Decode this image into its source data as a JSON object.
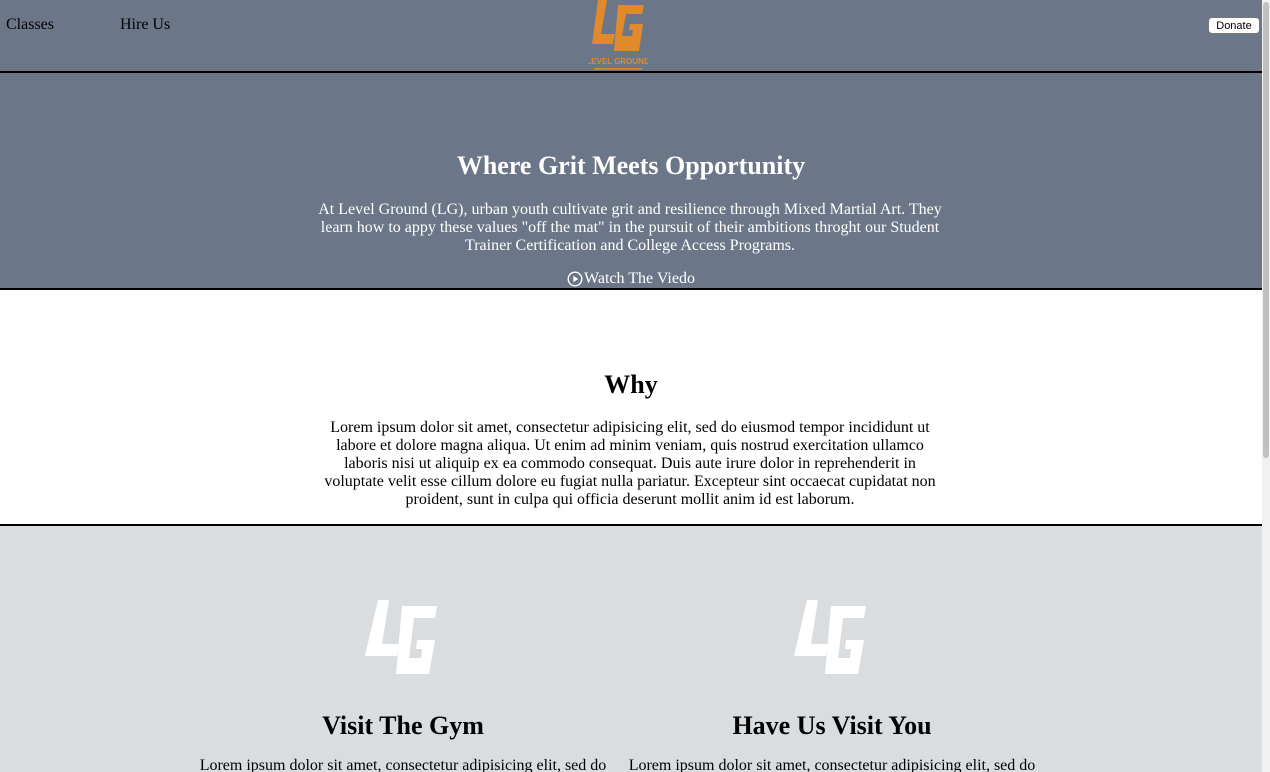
{
  "nav": {
    "classes_label": "Classes",
    "hire_label": "Hire Us",
    "donate_label": "Donate",
    "logo_icon": "level-ground-logo",
    "logo_caption": "LEVEL GROUND"
  },
  "hero": {
    "title": "Where Grit Meets Opportunity",
    "body": "At Level Ground (LG), urban youth cultivate grit and resilience through Mixed Martial Art. They learn how to appy these values \"off the mat\" in the pursuit of their ambitions throght our Student Trainer Certification and College Access Programs.",
    "watch_label": "Watch The Viedo",
    "watch_icon": "play-circle-icon"
  },
  "why": {
    "title": "Why",
    "body": "Lorem ipsum dolor sit amet, consectetur adipisicing elit, sed do eiusmod tempor incididunt ut labore et dolore magna aliqua. Ut enim ad minim veniam, quis nostrud exercitation ullamco laboris nisi ut aliquip ex ea commodo consequat. Duis aute irure dolor in reprehenderit in voluptate velit esse cillum dolore eu fugiat nulla pariatur. Excepteur sint occaecat cupidatat non proident, sunt in culpa qui officia deserunt mollit anim id est laborum."
  },
  "visit": {
    "gym": {
      "title": "Visit The Gym",
      "body": "Lorem ipsum dolor sit amet, consectetur adipisicing elit, sed do",
      "icon": "lg-logo-icon"
    },
    "you": {
      "title": "Have Us Visit You",
      "body": "Lorem ipsum dolor sit amet, consectetur adipisicing elit, sed do",
      "icon": "lg-logo-icon"
    }
  },
  "colors": {
    "header_bg": "#6b7788",
    "accent_orange": "#e08a2c",
    "visit_bg": "#dadde0"
  }
}
